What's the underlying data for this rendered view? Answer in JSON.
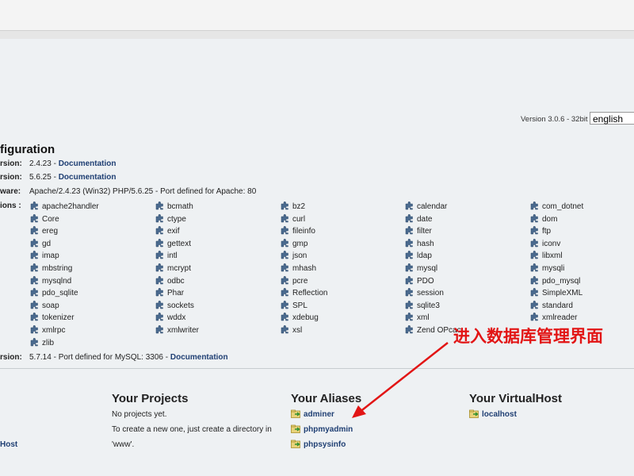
{
  "header": {
    "version": "Version 3.0.6 - 32bit",
    "language": "english"
  },
  "config": {
    "heading": "figuration",
    "rows": [
      {
        "label": "rsion:",
        "value": "2.4.23",
        "sep": " - ",
        "doc": "Documentation"
      },
      {
        "label": "rsion:",
        "value": "5.6.25",
        "sep": " - ",
        "doc": "Documentation"
      },
      {
        "label": "ware:",
        "value": "Apache/2.4.23 (Win32) PHP/5.6.25 - Port defined for Apache: 80",
        "sep": "",
        "doc": ""
      }
    ],
    "extensions_label": "ions :",
    "extensions": [
      "apache2handler",
      "bcmath",
      "bz2",
      "calendar",
      "com_dotnet",
      "Core",
      "ctype",
      "curl",
      "date",
      "dom",
      "ereg",
      "exif",
      "fileinfo",
      "filter",
      "ftp",
      "gd",
      "gettext",
      "gmp",
      "hash",
      "iconv",
      "imap",
      "intl",
      "json",
      "ldap",
      "libxml",
      "mbstring",
      "mcrypt",
      "mhash",
      "mysql",
      "mysqli",
      "mysqlnd",
      "odbc",
      "pcre",
      "PDO",
      "pdo_mysql",
      "pdo_sqlite",
      "Phar",
      "Reflection",
      "session",
      "SimpleXML",
      "soap",
      "sockets",
      "SPL",
      "sqlite3",
      "standard",
      "tokenizer",
      "wddx",
      "xdebug",
      "xml",
      "xmlreader",
      "xmlrpc",
      "xmlwriter",
      "xsl",
      "Zend OPcac",
      "",
      "zlib"
    ],
    "mysql": {
      "label": "rsion:",
      "value": "5.7.14 - Port defined for MySQL: 3306 -",
      "doc": "Documentation"
    }
  },
  "projects": {
    "title": "Your Projects",
    "line1": "No projects yet.",
    "line2": "To create a new one, just create a directory in",
    "line3": "'www'."
  },
  "aliases": {
    "title": "Your Aliases",
    "items": [
      "adminer",
      "phpmyadmin",
      "phpsysinfo"
    ]
  },
  "vhosts": {
    "title": "Your VirtualHost",
    "items": [
      "localhost"
    ]
  },
  "left_link": "Host",
  "annotation": {
    "text": "进入数据库管理界面",
    "color": "#e21515"
  }
}
